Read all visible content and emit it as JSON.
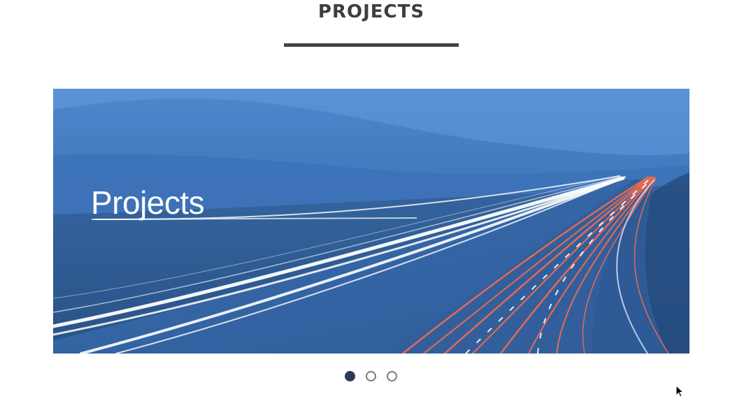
{
  "section": {
    "title": "PROJECTS"
  },
  "slider": {
    "active_index": 0,
    "slide_count": 3,
    "slides": [
      {
        "caption": "Projects",
        "image": "highway-light-trails-landscape"
      }
    ]
  },
  "colors": {
    "title": "#3e3e3e",
    "rule": "#444444",
    "dot_active": "#2c3a55",
    "dot_border": "#7a7a7a"
  }
}
